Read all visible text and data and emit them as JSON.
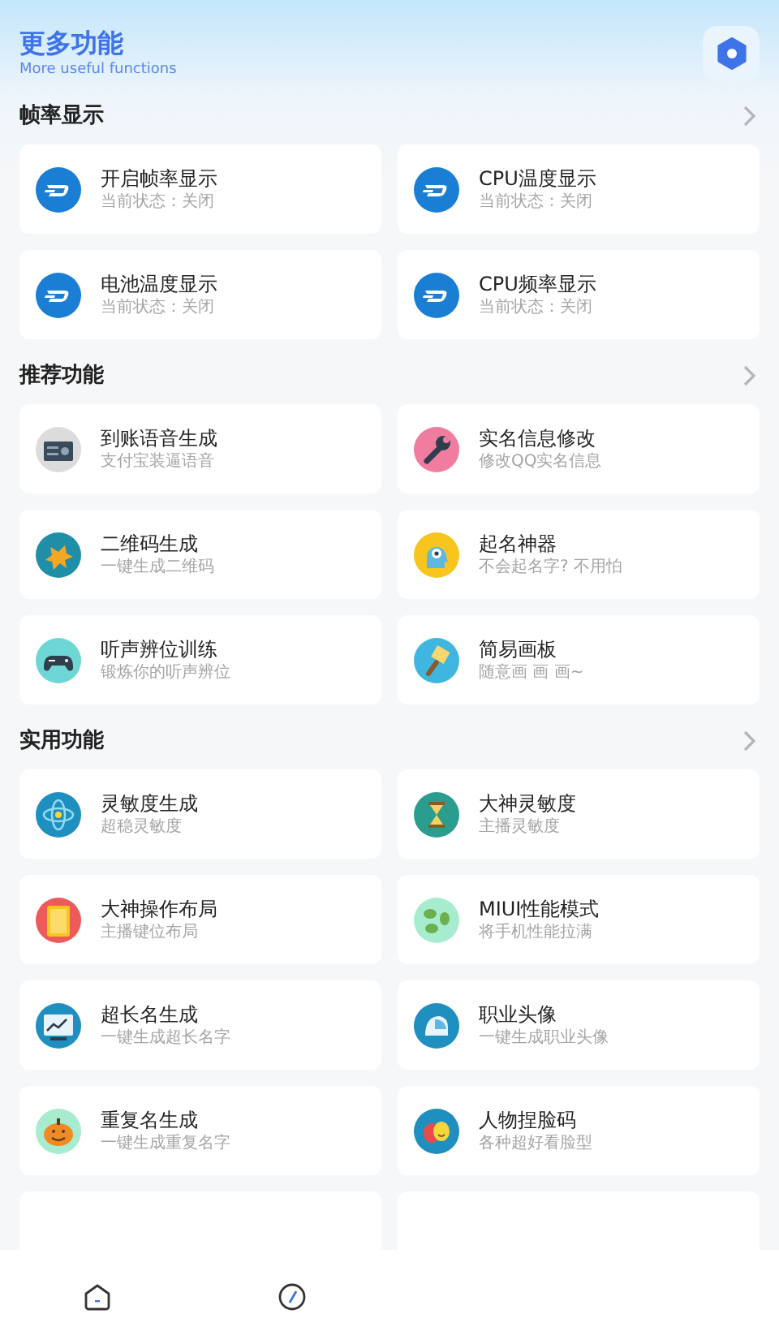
{
  "header": {
    "title": "更多功能",
    "subtitle": "More useful functions"
  },
  "sections": [
    {
      "title": "帧率显示",
      "items": [
        {
          "kind": "card",
          "title": "开启帧率显示",
          "subtitle": "当前状态：关闭"
        },
        {
          "kind": "card",
          "title": "CPU温度显示",
          "subtitle": "当前状态：关闭"
        },
        {
          "kind": "card",
          "title": "电池温度显示",
          "subtitle": "当前状态：关闭"
        },
        {
          "kind": "card",
          "title": "CPU频率显示",
          "subtitle": "当前状态：关闭"
        }
      ]
    },
    {
      "title": "推荐功能",
      "items": [
        {
          "kind": "card",
          "title": "到账语音生成",
          "subtitle": "支付宝装逼语音"
        },
        {
          "kind": "card",
          "title": "实名信息修改",
          "subtitle": "修改QQ实名信息"
        },
        {
          "kind": "card",
          "title": "二维码生成",
          "subtitle": "一键生成二维码"
        },
        {
          "kind": "card",
          "title": "起名神器",
          "subtitle": "不会起名字? 不用怕"
        },
        {
          "kind": "card",
          "title": "听声辨位训练",
          "subtitle": "锻炼你的听声辨位"
        },
        {
          "kind": "card",
          "title": "简易画板",
          "subtitle": "随意画 画 画~"
        }
      ]
    },
    {
      "title": "实用功能",
      "items": [
        {
          "kind": "card",
          "title": "灵敏度生成",
          "subtitle": "超稳灵敏度"
        },
        {
          "kind": "card",
          "title": "大神灵敏度",
          "subtitle": "主播灵敏度"
        },
        {
          "kind": "card",
          "title": "大神操作布局",
          "subtitle": "主播键位布局"
        },
        {
          "kind": "card",
          "title": "MIUI性能模式",
          "subtitle": "将手机性能拉满"
        },
        {
          "kind": "card",
          "title": "超长名生成",
          "subtitle": "一键生成超长名字"
        },
        {
          "kind": "card",
          "title": "职业头像",
          "subtitle": "一键生成职业头像"
        },
        {
          "kind": "card",
          "title": "重复名生成",
          "subtitle": "一键生成重复名字"
        },
        {
          "kind": "card",
          "title": "人物捏脸码",
          "subtitle": "各种超好看脸型"
        },
        {
          "kind": "cut"
        },
        {
          "kind": "cut"
        }
      ]
    }
  ]
}
